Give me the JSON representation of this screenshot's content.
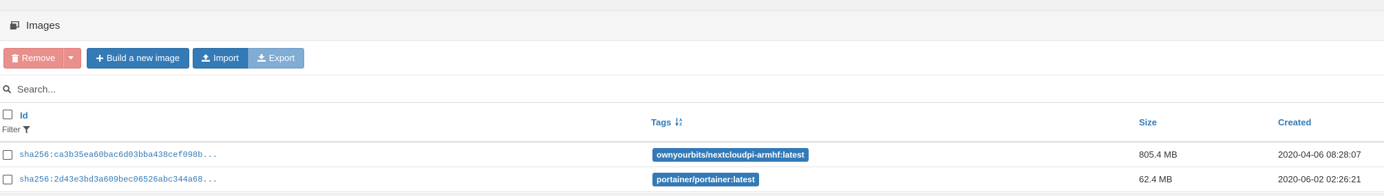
{
  "header": {
    "title": "Images",
    "icon": "clone-icon"
  },
  "actions": {
    "remove_label": "Remove",
    "build_label": "Build a new image",
    "import_label": "Import",
    "export_label": "Export"
  },
  "search": {
    "placeholder": "Search..."
  },
  "table": {
    "columns": {
      "id": "Id",
      "filter": "Filter",
      "tags": "Tags",
      "size": "Size",
      "created": "Created"
    },
    "rows": [
      {
        "id": "sha256:ca3b35ea60bac6d03bba438cef098b...",
        "tag": "ownyourbits/nextcloudpi-armhf:latest",
        "size": "805.4 MB",
        "created": "2020-04-06 08:28:07"
      },
      {
        "id": "sha256:2d43e3bd3a609bec06526abc344a68...",
        "tag": "portainer/portainer:latest",
        "size": "62.4 MB",
        "created": "2020-06-02 02:26:21"
      }
    ]
  },
  "colors": {
    "primary": "#337ab7",
    "danger_light": "#e98f8c",
    "primary_light": "#81acd3"
  }
}
